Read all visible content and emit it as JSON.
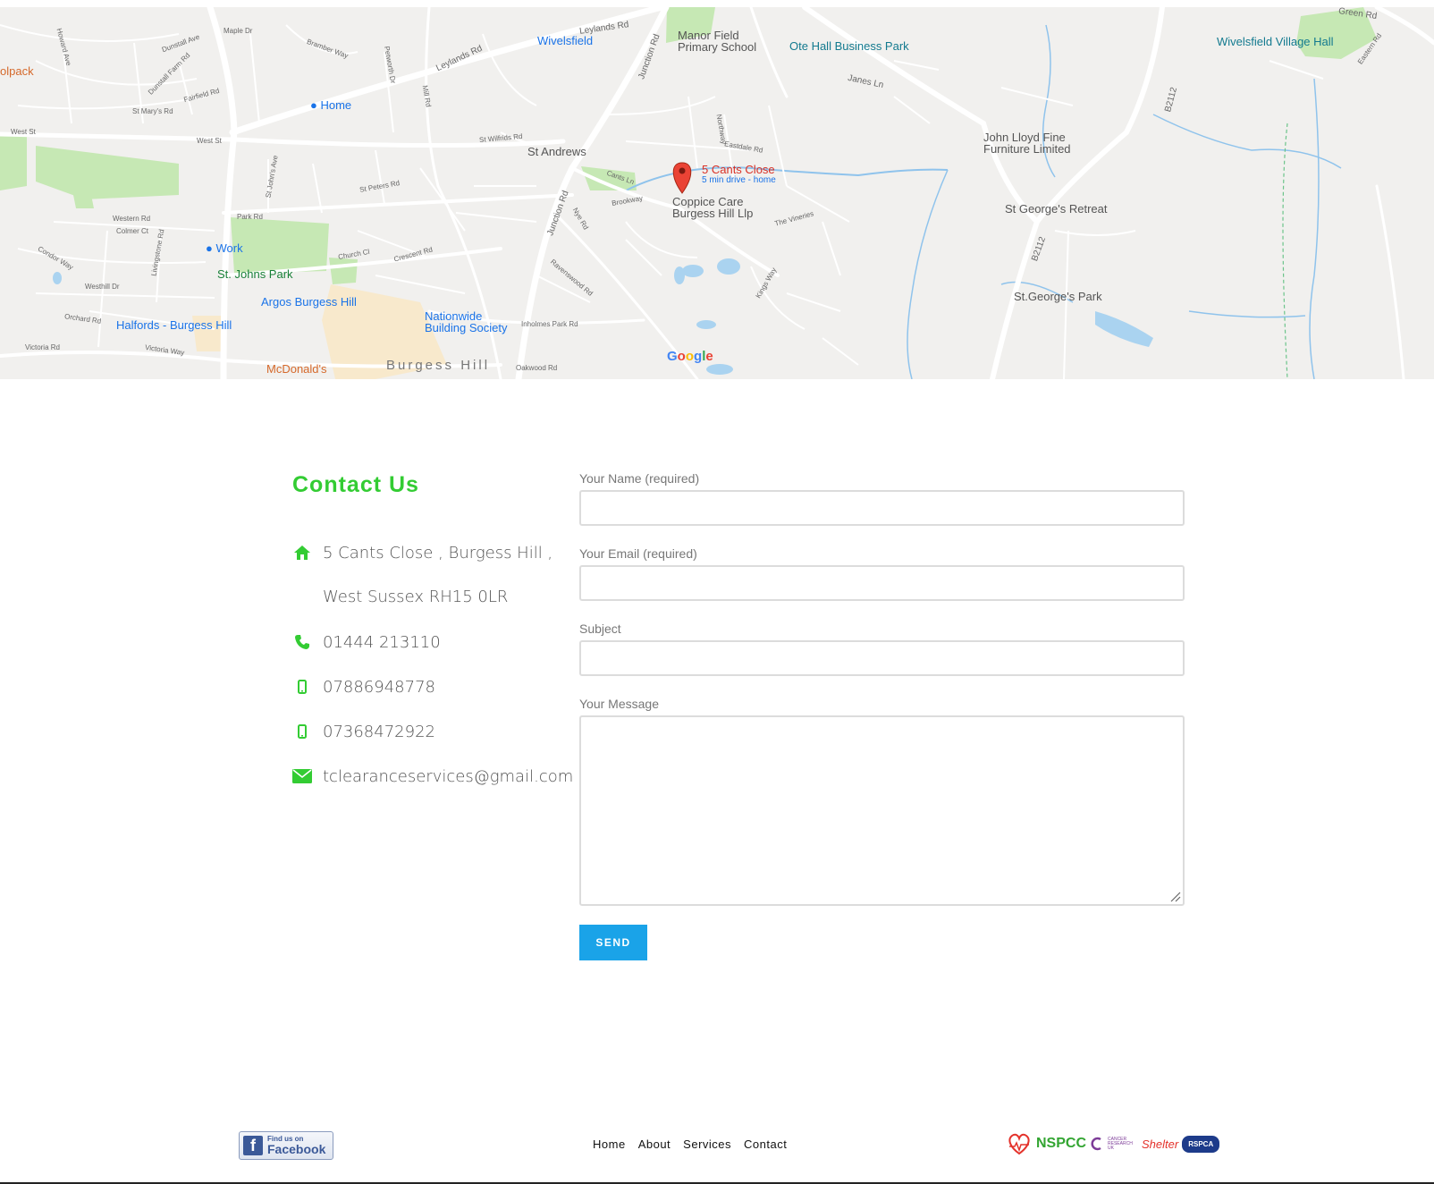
{
  "map": {
    "pin_title": "5 Cants Close",
    "pin_subtitle": "5 min drive - home",
    "places": {
      "home": "Home",
      "work": "Work",
      "wivelsfield": "Wivelsfield",
      "manor_field": "Manor Field",
      "primary_school": "Primary School",
      "ote_hall": "Ote Hall Business Park",
      "wivelsfield_hall": "Wivelsfield Village Hall",
      "john_lloyd": "John Lloyd Fine",
      "furniture": "Furniture Limited",
      "st_andrews": "St Andrews",
      "coppice_care": "Coppice Care",
      "burgess_hill_llp": "Burgess Hill Llp",
      "st_georges_retreat": "St George's Retreat",
      "st_georges_park": "St.George's Park",
      "st_johns_park": "St. Johns Park",
      "argos": "Argos Burgess Hill",
      "nationwide": "Nationwide",
      "building_society": "Building Society",
      "halfords": "Halfords - Burgess Hill",
      "mcdonalds": "McDonald's",
      "burgess_hill": "Burgess Hill",
      "olpack": "olpack"
    },
    "roads": {
      "leylands": "Leylands Rd",
      "leylands2": "Leylands Rd",
      "junction": "Junction Rd",
      "junction2": "Junction Rd",
      "janes": "Janes Ln",
      "b2112a": "B2112",
      "b2112b": "B2112",
      "green_rd": "Green Rd",
      "west_st": "West St",
      "west_st2": "West St",
      "park_rd": "Park Rd",
      "st_marys": "St Mary's Rd",
      "fairfield": "Fairfield Rd",
      "dunstall": "Dunstall Ave",
      "dunstall_farm": "Dunstall Farm Rd",
      "maple_dr": "Maple Dr",
      "bramber": "Bramber Way",
      "petworth": "Petworth Dr",
      "mill_rd": "Mill Rd",
      "st_wilfrids": "St Wilfrids Rd",
      "cants_ln": "Cants Ln",
      "brookway": "Brookway",
      "crescent": "Crescent Rd",
      "church_cl": "Church Cl",
      "western_rd": "Western Rd",
      "colmer_ct": "Colmer Ct",
      "orchard_rd": "Orchard Rd",
      "victoria_rd": "Victoria Rd",
      "victoria_way": "Victoria Way",
      "inholmes": "Inholmes Park Rd",
      "oakwood": "Oakwood Rd",
      "ravenswood": "Ravenswood Rd",
      "nye_rd": "Nye Rd",
      "kings_way": "Kings Way",
      "the_vineries": "The Vineries",
      "eastdale": "Eastdale Rd",
      "northway": "Northway",
      "st_peters": "St Peters Rd",
      "st_johns_ave": "St John's Ave",
      "livingstone": "Livingstone Rd",
      "westhill": "Westhill Dr",
      "condor": "Condor Way",
      "howard": "Howard Ave",
      "eastern": "Eastern Rd"
    },
    "google": [
      "G",
      "o",
      "o",
      "g",
      "l",
      "e"
    ]
  },
  "contact": {
    "title": "Contact Us",
    "address_line1": "5 Cants Close , Burgess Hill ,",
    "address_line2": "West Sussex RH15 0LR",
    "phone": "01444 213110",
    "mobile1": "07886948778",
    "mobile2": "07368472922",
    "email": "tclearanceservices@gmail.com"
  },
  "form": {
    "name_label": "Your Name (required)",
    "email_label": "Your Email (required)",
    "subject_label": "Subject",
    "message_label": "Your Message",
    "send_label": "SEND"
  },
  "footer": {
    "facebook_small": "Find us on",
    "facebook_big": "Facebook",
    "nav": [
      "Home",
      "About",
      "Services",
      "Contact"
    ],
    "charities": {
      "nspcc": "NSPCC",
      "cruk": "CANCER RESEARCH UK",
      "shelter": "Shelter",
      "rspca": "RSPCA"
    }
  },
  "colors": {
    "accent_green": "#33cc33",
    "send_blue": "#1aa3e8",
    "pin_red": "#d93025"
  }
}
